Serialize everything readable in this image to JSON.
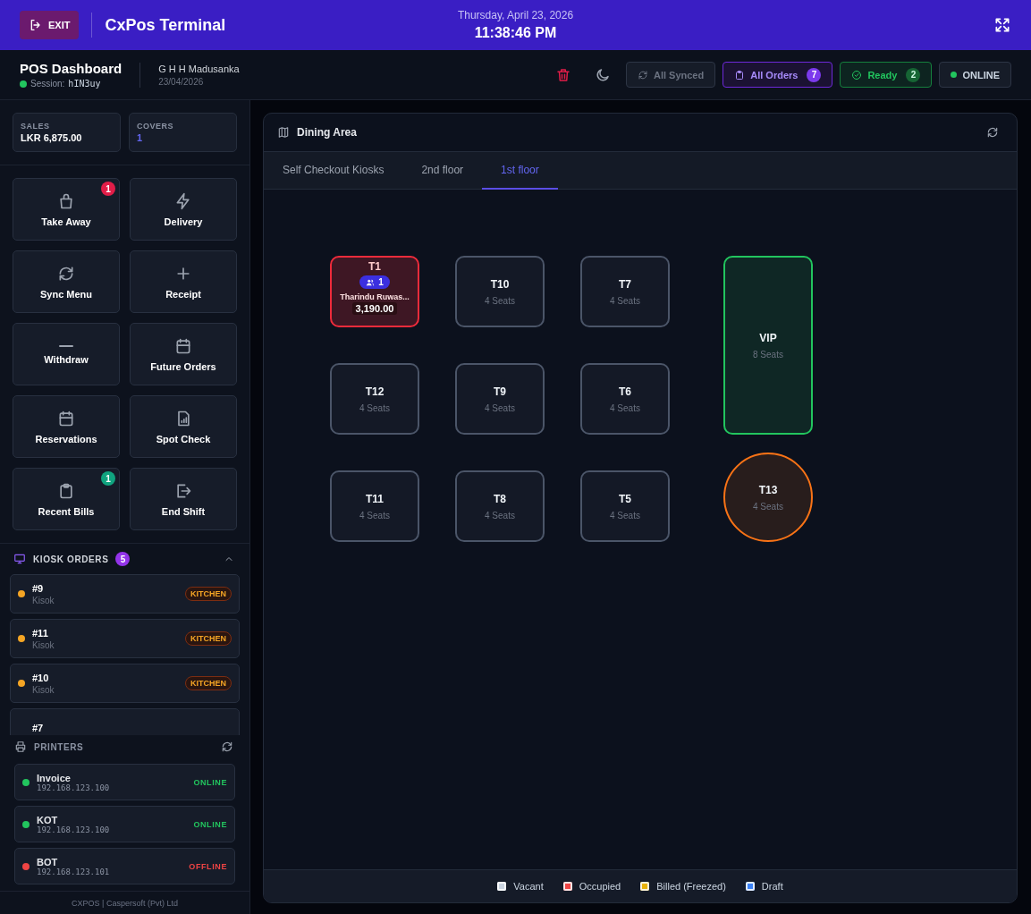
{
  "top_bar": {
    "exit_label": "EXIT",
    "app_title": "CxPos Terminal",
    "date": "Thursday, April 23, 2026",
    "time": "11:38:46 PM"
  },
  "sub_bar": {
    "title": "POS Dashboard",
    "session_label": "Session:",
    "session_id": "hIN3uy",
    "user": "G H H Madusanka",
    "user_date": "23/04/2026",
    "chips": [
      {
        "kind": "synced",
        "label": "All Synced",
        "disabled": true
      },
      {
        "kind": "orders",
        "label": "All Orders",
        "count": "7"
      },
      {
        "kind": "ready",
        "label": "Ready",
        "count": "2"
      },
      {
        "kind": "online",
        "label": "ONLINE"
      }
    ]
  },
  "stats": [
    {
      "label": "SALES",
      "value": "LKR 6,875.00",
      "kind": "money"
    },
    {
      "label": "COVERS",
      "value": "1",
      "kind": "count"
    }
  ],
  "actions": [
    {
      "label": "Take Away",
      "kind": "bag",
      "badge": "1",
      "color": "#e11d48"
    },
    {
      "label": "Delivery",
      "kind": "bolt"
    },
    {
      "label": "Sync Menu",
      "kind": "sync"
    },
    {
      "label": "Receipt",
      "kind": "plus"
    },
    {
      "label": "Withdraw",
      "kind": "minus"
    },
    {
      "label": "Future Orders",
      "kind": "calendar"
    },
    {
      "label": "Reservations",
      "kind": "calendar"
    },
    {
      "label": "Spot Check",
      "kind": "report"
    },
    {
      "label": "Recent Bills",
      "kind": "clipboard",
      "badge": "1",
      "color": "#10a37f"
    },
    {
      "label": "End Shift",
      "kind": "logout"
    }
  ],
  "kiosk_orders": {
    "title": "KIOSK ORDERS",
    "count": "5",
    "expanded": true,
    "items": [
      {
        "number": "#9",
        "source": "Kisok",
        "status": "KITCHEN",
        "color": "#f5a524"
      },
      {
        "number": "#11",
        "source": "Kisok",
        "status": "KITCHEN",
        "color": "#f5a524"
      },
      {
        "number": "#10",
        "source": "Kisok",
        "status": "KITCHEN",
        "color": "#f5a524"
      },
      {
        "number": "#7"
      }
    ]
  },
  "printers": {
    "title": "PRINTERS",
    "items": [
      {
        "name": "Invoice",
        "ip": "192.168.123.100",
        "online": true,
        "status": "ONLINE"
      },
      {
        "name": "KOT",
        "ip": "192.168.123.100",
        "online": true,
        "status": "ONLINE"
      },
      {
        "name": "BOT",
        "ip": "192.168.123.101",
        "online": false,
        "status": "OFFLINE"
      }
    ]
  },
  "footer": "CXPOS | Caspersoft (Pvt) Ltd",
  "dining": {
    "title": "Dining Area",
    "tabs": [
      {
        "label": "Self Checkout Kiosks",
        "selected": false
      },
      {
        "label": "2nd floor",
        "selected": false
      },
      {
        "label": "1st floor",
        "selected": true
      }
    ],
    "tables": [
      {
        "name": "T1",
        "kind": "square",
        "color": "#ef2b3b",
        "guests": "1",
        "customer": "Tharindu Ruwas...",
        "amount": "3,190.00"
      },
      {
        "name": "T10",
        "kind": "square",
        "color": "#4b5568",
        "seats": "4 Seats"
      },
      {
        "name": "T7",
        "kind": "square",
        "color": "#4b5568",
        "seats": "4 Seats"
      },
      {
        "name": "VIP",
        "kind": "tall",
        "color": "#22c55e",
        "seats": "8 Seats"
      },
      {
        "name": "T12",
        "kind": "square",
        "color": "#4b5568",
        "seats": "4 Seats"
      },
      {
        "name": "T9",
        "kind": "square",
        "color": "#4b5568",
        "seats": "4 Seats"
      },
      {
        "name": "T6",
        "kind": "square",
        "color": "#4b5568",
        "seats": "4 Seats"
      },
      {
        "name": "T11",
        "kind": "square",
        "color": "#4b5568",
        "seats": "4 Seats"
      },
      {
        "name": "T8",
        "kind": "square",
        "color": "#4b5568",
        "seats": "4 Seats"
      },
      {
        "name": "T5",
        "kind": "square",
        "color": "#4b5568",
        "seats": "4 Seats"
      },
      {
        "name": "T13",
        "kind": "round",
        "color": "#f97316",
        "seats": "4 Seats"
      }
    ],
    "legend": [
      {
        "label": "Vacant",
        "color": "#cbd5e1"
      },
      {
        "label": "Occupied",
        "color": "#ef4444"
      },
      {
        "label": "Billed (Freezed)",
        "color": "#eab308"
      },
      {
        "label": "Draft",
        "color": "#3b82f6"
      }
    ]
  }
}
